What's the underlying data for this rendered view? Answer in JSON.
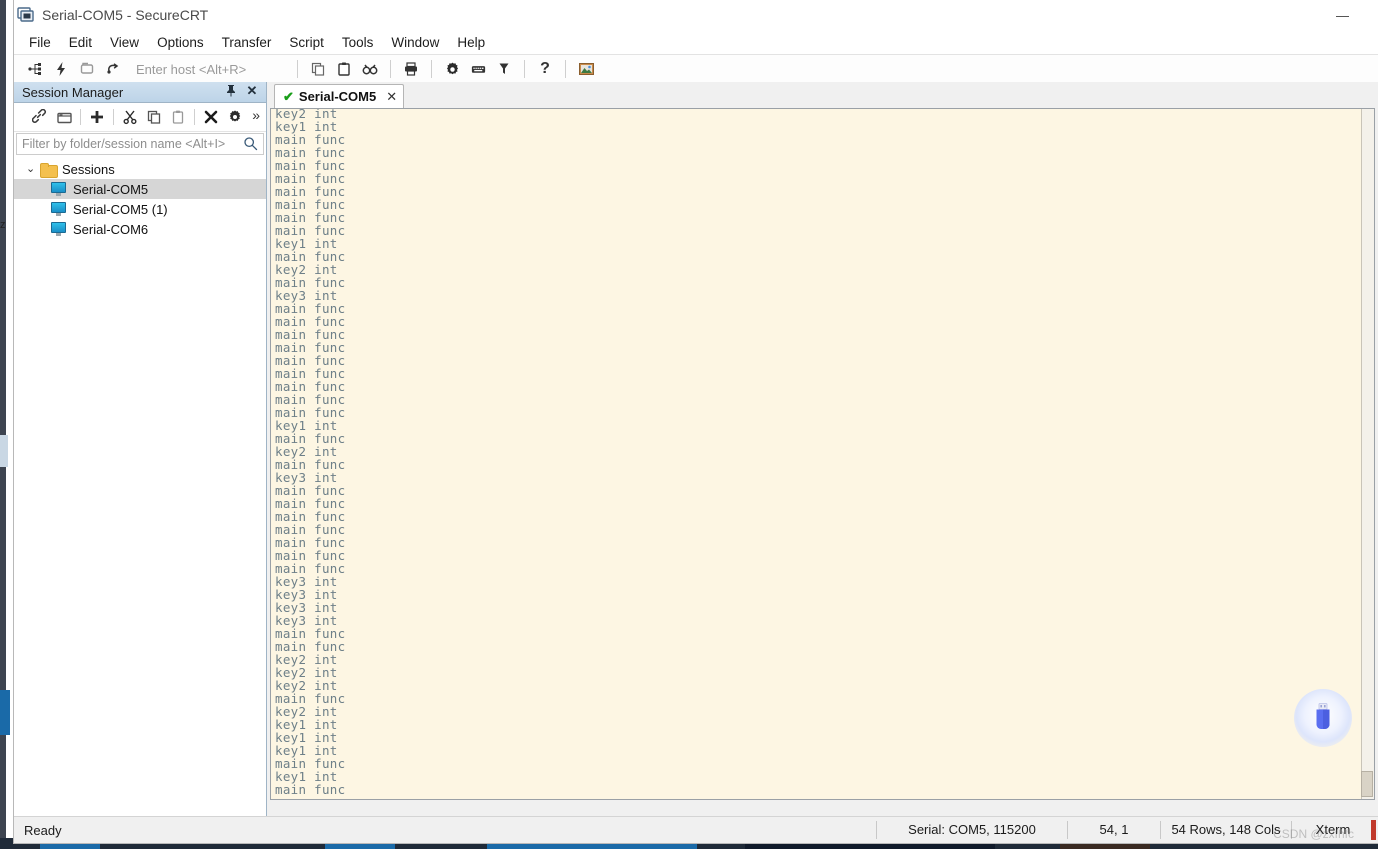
{
  "window": {
    "title": "Serial-COM5 - SecureCRT",
    "app_icon": "securecrt-icon",
    "minimize_label": "Minimize"
  },
  "menu": {
    "items": [
      {
        "label": "File"
      },
      {
        "label": "Edit"
      },
      {
        "label": "View"
      },
      {
        "label": "Options"
      },
      {
        "label": "Transfer"
      },
      {
        "label": "Script"
      },
      {
        "label": "Tools"
      },
      {
        "label": "Window"
      },
      {
        "label": "Help"
      }
    ]
  },
  "toolbar": {
    "host_entry_placeholder": "Enter host <Alt+R>",
    "items": [
      {
        "name": "connect-icon",
        "tooltip": "Connect"
      },
      {
        "name": "quick-connect-icon",
        "tooltip": "Quick Connect"
      },
      {
        "name": "connect-in-tab-icon",
        "tooltip": "Connect in Tab"
      },
      {
        "name": "reconnect-icon",
        "tooltip": "Reconnect"
      },
      {
        "name": "copy-icon",
        "tooltip": "Copy"
      },
      {
        "name": "paste-icon",
        "tooltip": "Paste"
      },
      {
        "name": "find-icon",
        "tooltip": "Find"
      },
      {
        "name": "print-icon",
        "tooltip": "Print"
      },
      {
        "name": "session-options-icon",
        "tooltip": "Session Options"
      },
      {
        "name": "keyboard-icon",
        "tooltip": "Keymap Editor"
      },
      {
        "name": "filter-icon",
        "tooltip": "Filter"
      },
      {
        "name": "help-icon",
        "tooltip": "Help"
      },
      {
        "name": "image-icon",
        "tooltip": "Screenshot"
      }
    ]
  },
  "session_manager": {
    "title": "Session Manager",
    "pin_icon": "pin-icon",
    "close_icon": "close-icon",
    "overflow_label": "»",
    "toolbar_items": [
      {
        "name": "connect-session-icon",
        "tooltip": "Connect"
      },
      {
        "name": "new-folder-icon",
        "tooltip": "New Folder"
      },
      {
        "name": "new-session-icon",
        "tooltip": "New Session"
      },
      {
        "name": "cut-icon",
        "tooltip": "Cut"
      },
      {
        "name": "copy-icon",
        "tooltip": "Copy"
      },
      {
        "name": "paste-icon",
        "tooltip": "Paste"
      },
      {
        "name": "delete-icon",
        "tooltip": "Delete"
      },
      {
        "name": "properties-icon",
        "tooltip": "Properties"
      }
    ],
    "filter_placeholder": "Filter by folder/session name <Alt+I>",
    "search_icon": "search-icon",
    "tree": {
      "root": {
        "label": "Sessions",
        "expanded": true,
        "chevron": "⌄"
      },
      "sessions": [
        {
          "label": "Serial-COM5",
          "selected": true
        },
        {
          "label": "Serial-COM5 (1)",
          "selected": false
        },
        {
          "label": "Serial-COM6",
          "selected": false
        }
      ]
    }
  },
  "tabs": [
    {
      "label": "Serial-COM5",
      "connected": true,
      "check_icon": "green-check-icon",
      "close_icon": "close-icon"
    }
  ],
  "terminal": {
    "background_color": "#fdf6e3",
    "text_color": "#6d7f88",
    "lines": [
      "key2 int",
      "key1 int",
      "main func",
      "main func",
      "main func",
      "main func",
      "main func",
      "main func",
      "main func",
      "main func",
      "key1 int",
      "main func",
      "key2 int",
      "main func",
      "key3 int",
      "main func",
      "main func",
      "main func",
      "main func",
      "main func",
      "main func",
      "main func",
      "main func",
      "main func",
      "key1 int",
      "main func",
      "key2 int",
      "main func",
      "key3 int",
      "main func",
      "main func",
      "main func",
      "main func",
      "main func",
      "main func",
      "main func",
      "key3 int",
      "key3 int",
      "key3 int",
      "key3 int",
      "main func",
      "main func",
      "key2 int",
      "key2 int",
      "key2 int",
      "main func",
      "key2 int",
      "key1 int",
      "key1 int",
      "key1 int",
      "main func",
      "key1 int",
      "main func"
    ]
  },
  "overlay": {
    "usb_icon": "usb-drive-icon"
  },
  "status_bar": {
    "ready": "Ready",
    "serial": "Serial: COM5, 115200",
    "cursor": "54,  1",
    "dimensions": "54 Rows, 148 Cols",
    "emulation": "Xterm",
    "watermark": "CSDN @zxfhfc"
  }
}
